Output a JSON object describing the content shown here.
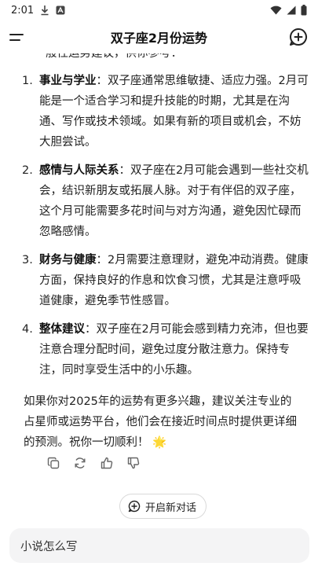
{
  "status": {
    "time": "2:01"
  },
  "header": {
    "title": "双子座2月份运势"
  },
  "content": {
    "cut_line": "般性运势建议，供你参考：",
    "items": [
      {
        "num": "1.",
        "bold": "事业与学业",
        "text": "：双子座通常思维敏捷、适应力强。2月可能是一个适合学习和提升技能的时期，尤其是在沟通、写作或技术领域。如果有新的项目或机会，不妨大胆尝试。"
      },
      {
        "num": "2.",
        "bold": "感情与人际关系",
        "text": "：双子座在2月可能会遇到一些社交机会，结识新朋友或拓展人脉。对于有伴侣的双子座，这个月可能需要多花时间与对方沟通，避免因忙碌而忽略感情。"
      },
      {
        "num": "3.",
        "bold": "财务与健康",
        "text": "：2月需要注意理财，避免冲动消费。健康方面，保持良好的作息和饮食习惯，尤其是注意呼吸道健康，避免季节性感冒。"
      },
      {
        "num": "4.",
        "bold": "整体建议",
        "text": "：双子座在2月可能会感到精力充沛，但也要注意合理分配时间，避免过度分散注意力。保持专注，同时享受生活中的小乐趣。"
      }
    ],
    "closing": "如果你对2025年的运势有更多兴趣，建议关注专业的占星师或运势平台，他们会在接近时间点时提供更详细的预测。祝你一切顺利！",
    "closing_emoji": "🌟"
  },
  "pill": {
    "label": "开启新对话"
  },
  "input": {
    "placeholder": "小说怎么写"
  }
}
